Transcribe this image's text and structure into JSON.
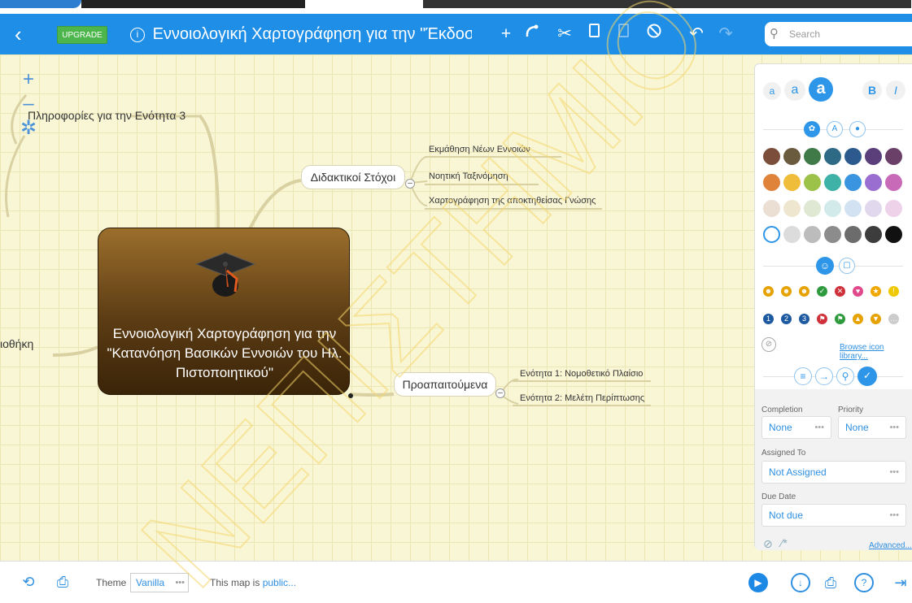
{
  "toolbar": {
    "upgrade_label": "UPGRADE",
    "document_title": "Εννοιολογική Χαρτογράφηση για την \"Έκδοσ...",
    "title_dropdown_glyph": "⬍",
    "search_placeholder": "Search"
  },
  "mindmap": {
    "central_topic": "Εννοιολογική Χαρτογράφηση για την \"Κατανόηση Βασικών Εννοιών του Ηλ. Πιστοποιητικού\"",
    "left_top_node": "Πληροφορίες για την Ενότητα 3",
    "left_bottom_node": "ιοθήκη",
    "branch_goals": {
      "label": "Διδακτικοί Στόχοι",
      "children": [
        "Εκμάθηση Νέων Εννοιών",
        "Νοητική Ταξινόμηση",
        "Χαρτογράφηση της αποκτηθείσας Γνώσης"
      ]
    },
    "branch_prereq": {
      "label": "Προαπαιτούμενα",
      "children": [
        "Ενότητα 1: Νομοθετικό Πλαίσιο",
        "Ενότητα 2: Μελέτη Περίπτωσης"
      ]
    },
    "collapse_glyph": "–"
  },
  "panel": {
    "font_sizes": [
      "a",
      "a",
      "a"
    ],
    "bold_label": "B",
    "italic_label": "I",
    "colors": [
      "#7a4e3a",
      "#6a5a3e",
      "#3f7a48",
      "#2e6a86",
      "#2c5a8e",
      "#5a3f7a",
      "#6a3f68",
      "#e0833a",
      "#f0bd3a",
      "#9cc24a",
      "#3fb2a8",
      "#3a94e0",
      "#9a6ed0",
      "#c86ab8",
      "#eadfd2",
      "#efe6d0",
      "#dee8d2",
      "#d2eaea",
      "#d2e2f2",
      "#e2d8ee",
      "#eed2ea",
      "#ffffff",
      "#dcdcdc",
      "#bcbcbc",
      "#8c8c8c",
      "#6c6c6c",
      "#3c3c3c",
      "#111111"
    ],
    "browse_label": "Browse icon library...",
    "completion_label": "Completion",
    "priority_label": "Priority",
    "completion_value": "None",
    "priority_value": "None",
    "assigned_label": "Assigned To",
    "assigned_value": "Not Assigned",
    "due_label": "Due Date",
    "due_value": "Not due",
    "advanced_label": "Advanced...",
    "dots": "•••"
  },
  "bottom": {
    "theme_label": "Theme",
    "theme_value": "Vanilla",
    "map_public_prefix": "This map is ",
    "map_public_link": "public..."
  },
  "watermark": "ΝΕΠΙΣΤΗΜΙΟ"
}
